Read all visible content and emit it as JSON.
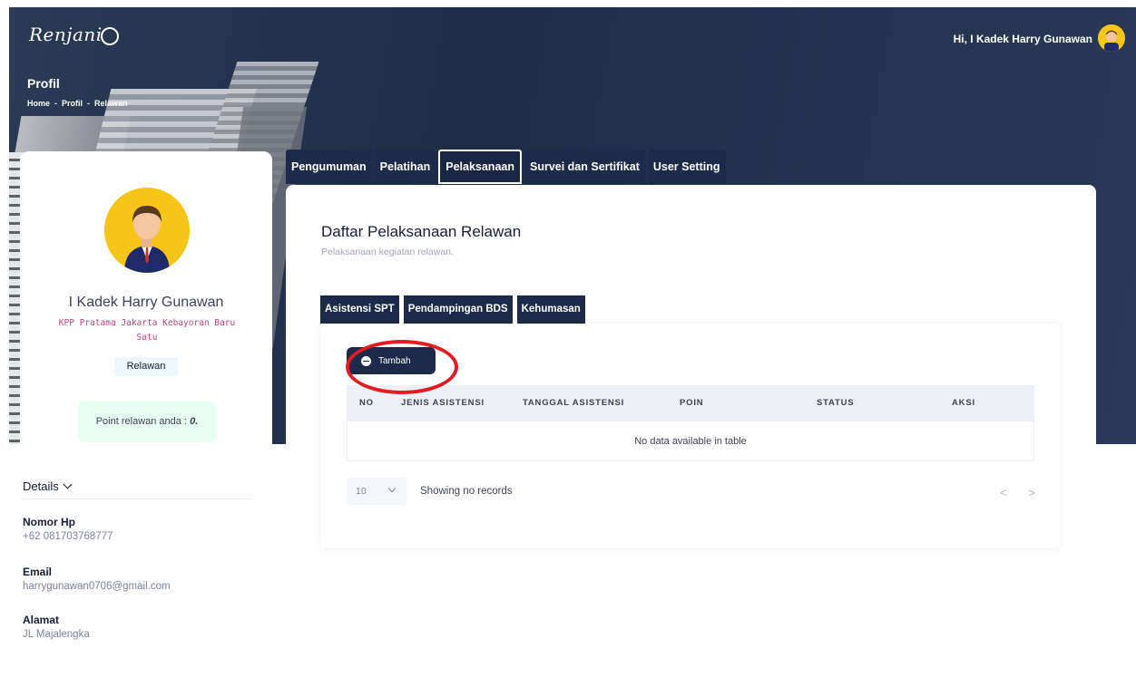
{
  "header": {
    "logo_text": "Renjani",
    "page_title": "Profil",
    "breadcrumb": [
      "Home",
      "Profil",
      "Relawan"
    ],
    "breadcrumb_sep": "-",
    "greeting": "Hi, I Kadek Harry Gunawan"
  },
  "profile": {
    "name": "I Kadek Harry Gunawan",
    "office": "KPP Pratama Jakarta Kebayoran Baru Satu",
    "role": "Relawan",
    "point_prefix": "Point relawan anda : ",
    "point_value": "0.",
    "details_label": "Details",
    "fields": [
      {
        "label": "Nomor Hp",
        "value": "+62 081703768777"
      },
      {
        "label": "Email",
        "value": "harrygunawan0706@gmail.com"
      },
      {
        "label": "Alamat",
        "value": "JL Majalengka"
      }
    ]
  },
  "tabs": [
    {
      "label": "Pengumuman",
      "active": false
    },
    {
      "label": "Pelatihan",
      "active": false
    },
    {
      "label": "Pelaksanaan",
      "active": true
    },
    {
      "label": "Survei dan Sertifikat",
      "active": false
    },
    {
      "label": "User Setting",
      "active": false
    }
  ],
  "main": {
    "title": "Daftar Pelaksanaan Relawan",
    "subtitle": "Pelaksanaan kegiatan relawan.",
    "subtabs": [
      "Asistensi SPT",
      "Pendampingan BDS",
      "Kehumasan"
    ],
    "add_button": "Tambah",
    "table": {
      "columns": [
        "NO",
        "JENIS ASISTENSI",
        "TANGGAL ASISTENSI",
        "POIN",
        "STATUS",
        "AKSI"
      ],
      "empty_text": "No data available in table"
    },
    "page_size": "10",
    "showing_text": "Showing no records",
    "prev": "<",
    "next": ">"
  },
  "colors": {
    "navy": "#1e2a4a",
    "highlight": "#e31b23",
    "avatar_bg": "#f5c518"
  }
}
